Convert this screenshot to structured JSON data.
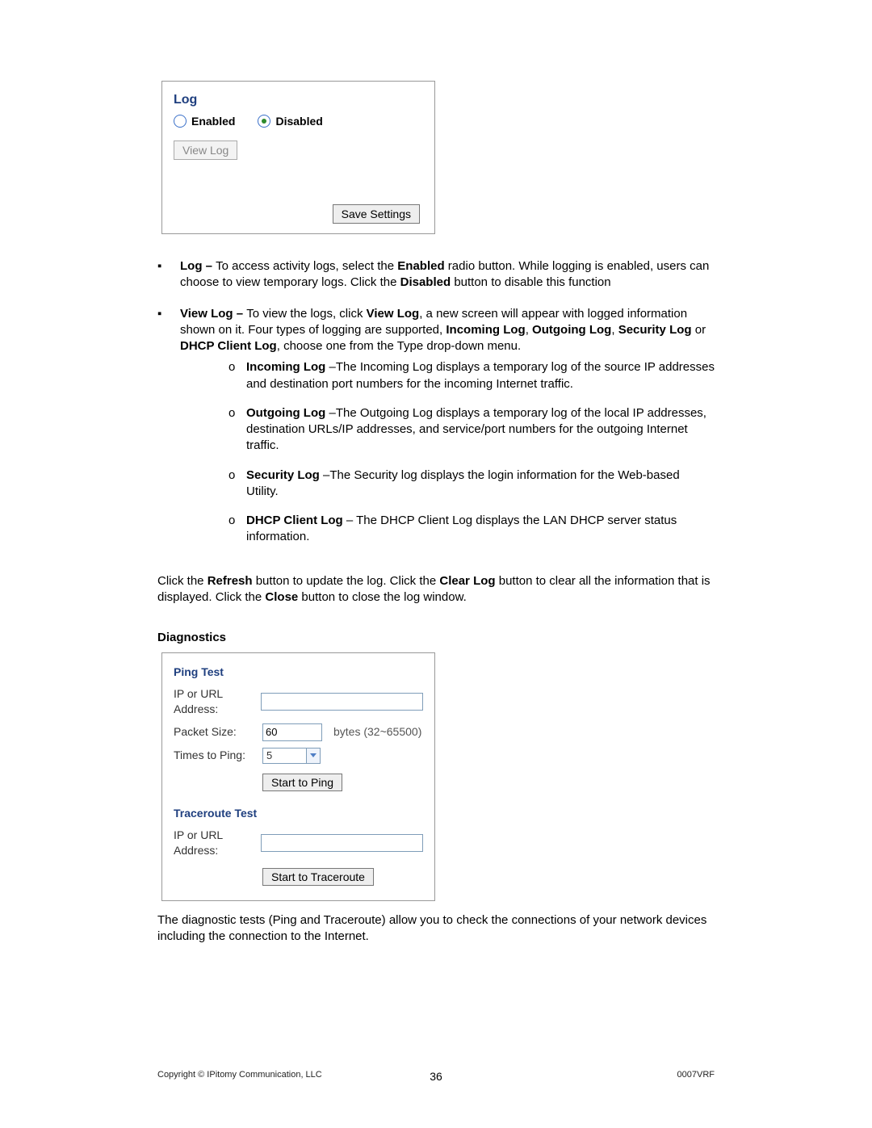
{
  "log_panel": {
    "title": "Log",
    "enabled_label": "Enabled",
    "disabled_label": "Disabled",
    "view_log_label": "View Log",
    "save_settings_label": "Save Settings"
  },
  "bullets": {
    "log": {
      "lead": "Log – ",
      "body1": "To access activity logs, select the ",
      "b1": "Enabled",
      "body2": " radio button. While logging is enabled, users can choose to view temporary logs. Click the ",
      "b2": "Disabled",
      "body3": " button to disable this function"
    },
    "viewlog": {
      "lead": "View Log – ",
      "body1": "To view the logs, click ",
      "b1": "View Log",
      "body2": ", a new screen will appear with logged information shown on it. Four types of logging are supported, ",
      "b2": "Incoming Log",
      "sep1": ", ",
      "b3": "Outgoing Log",
      "sep2": ", ",
      "b4": "Security Log",
      "sep3": " or ",
      "b5": "DHCP Client Log",
      "body3": ", choose one from the Type drop-down menu."
    },
    "sub": {
      "inc": {
        "lead": "Incoming Log",
        "body": " –The Incoming Log displays a temporary log of the source IP addresses and destination port numbers for the incoming Internet traffic."
      },
      "out": {
        "lead": "Outgoing Log",
        "body": " –The Outgoing Log displays a temporary log of the local IP addresses, destination URLs/IP addresses, and service/port numbers for the outgoing Internet traffic."
      },
      "sec": {
        "lead": "Security Log",
        "body": " –The Security log displays the login information for the Web-based Utility."
      },
      "dhcp": {
        "lead": "DHCP Client Log",
        "body": " – The DHCP Client Log displays the LAN DHCP server status information."
      }
    }
  },
  "para": {
    "p1a": "Click the ",
    "b1": "Refresh",
    "p1b": " button to update the log. Click the ",
    "b2": "Clear Log",
    "p1c": " button to clear all the information that is displayed. Click the ",
    "b3": "Close",
    "p1d": " button to close the log window."
  },
  "diag": {
    "heading": "Diagnostics",
    "ping_title": "Ping Test",
    "ip_label": "IP or URL Address:",
    "packet_size_label": "Packet Size:",
    "packet_size_value": "60",
    "packet_size_unit": "bytes (32~65500)",
    "times_label": "Times to Ping:",
    "times_value": "5",
    "start_ping_label": "Start to Ping",
    "tracer_title": "Traceroute Test",
    "start_tracer_label": "Start to Traceroute",
    "after_text": "The diagnostic tests (Ping and Traceroute) allow you to check the connections of your network devices including the connection to the Internet."
  },
  "footer": {
    "left": "Copyright © IPitomy Communication, LLC",
    "center": "36",
    "right": "0007VRF"
  }
}
